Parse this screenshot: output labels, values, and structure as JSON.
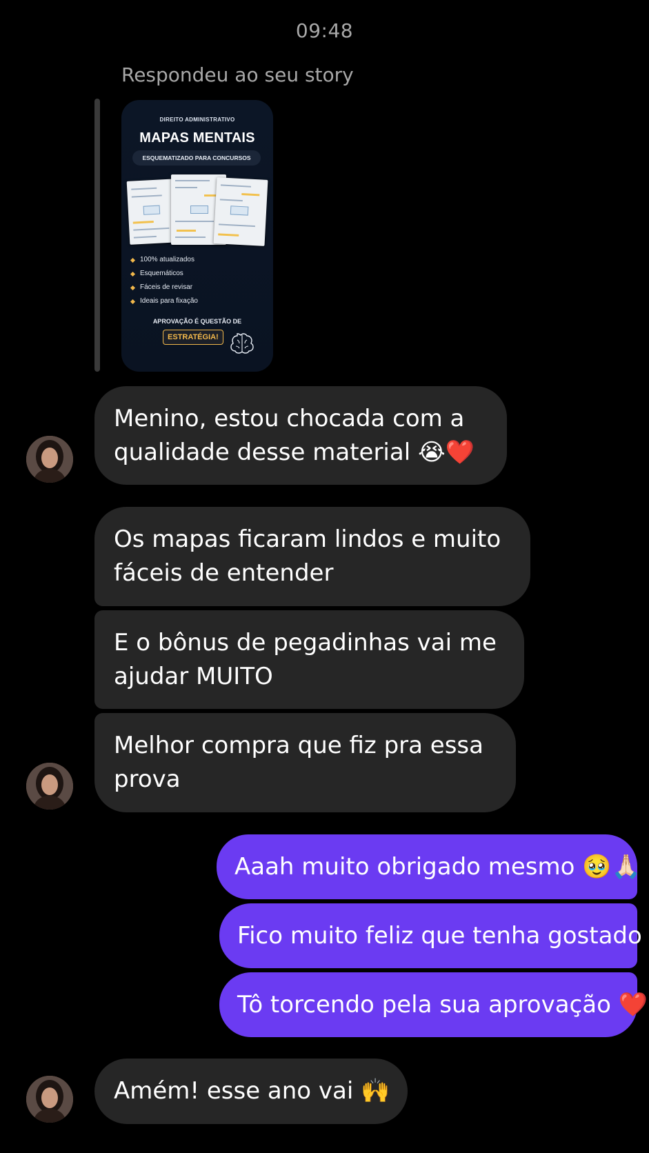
{
  "header": {
    "time": "09:48"
  },
  "story_reply": {
    "caption": "Respondeu ao seu story",
    "card": {
      "kicker": "DIREITO ADMINISTRATIVO",
      "title": "MAPAS MENTAIS",
      "subtitle": "ESQUEMATIZADO PARA CONCURSOS",
      "features": [
        "100% atualizados",
        "Esquemáticos",
        "Fáceis de revisar",
        "Ideais para fixação"
      ],
      "cta": "APROVAÇÃO É QUESTÃO DE",
      "badge": "ESTRATÉGIA!"
    }
  },
  "messages": [
    {
      "from": "them",
      "text": "Menino, estou chocada com a qualidade desse material 😭❤️"
    },
    {
      "from": "them",
      "text": "Os mapas ficaram lindos e muito fáceis de entender"
    },
    {
      "from": "them",
      "text": "E o bônus de pegadinhas vai me ajudar MUITO"
    },
    {
      "from": "them",
      "text": "Melhor compra que fiz pra essa prova"
    },
    {
      "from": "me",
      "text": "Aaah muito obrigado mesmo 🥹🙏🏻"
    },
    {
      "from": "me",
      "text": "Fico muito feliz que tenha gostado"
    },
    {
      "from": "me",
      "text": "Tô torcendo pela sua aprovação ❤️"
    },
    {
      "from": "them",
      "text": "Amém! esse ano vai 🙌"
    }
  ],
  "colors": {
    "background": "#000000",
    "incoming_bubble": "#262626",
    "outgoing_bubble": "#6b3bf2",
    "meta_text": "#a8a8a8"
  },
  "icons": {
    "avatar": "contact-avatar",
    "story_brain": "brain-icon"
  }
}
